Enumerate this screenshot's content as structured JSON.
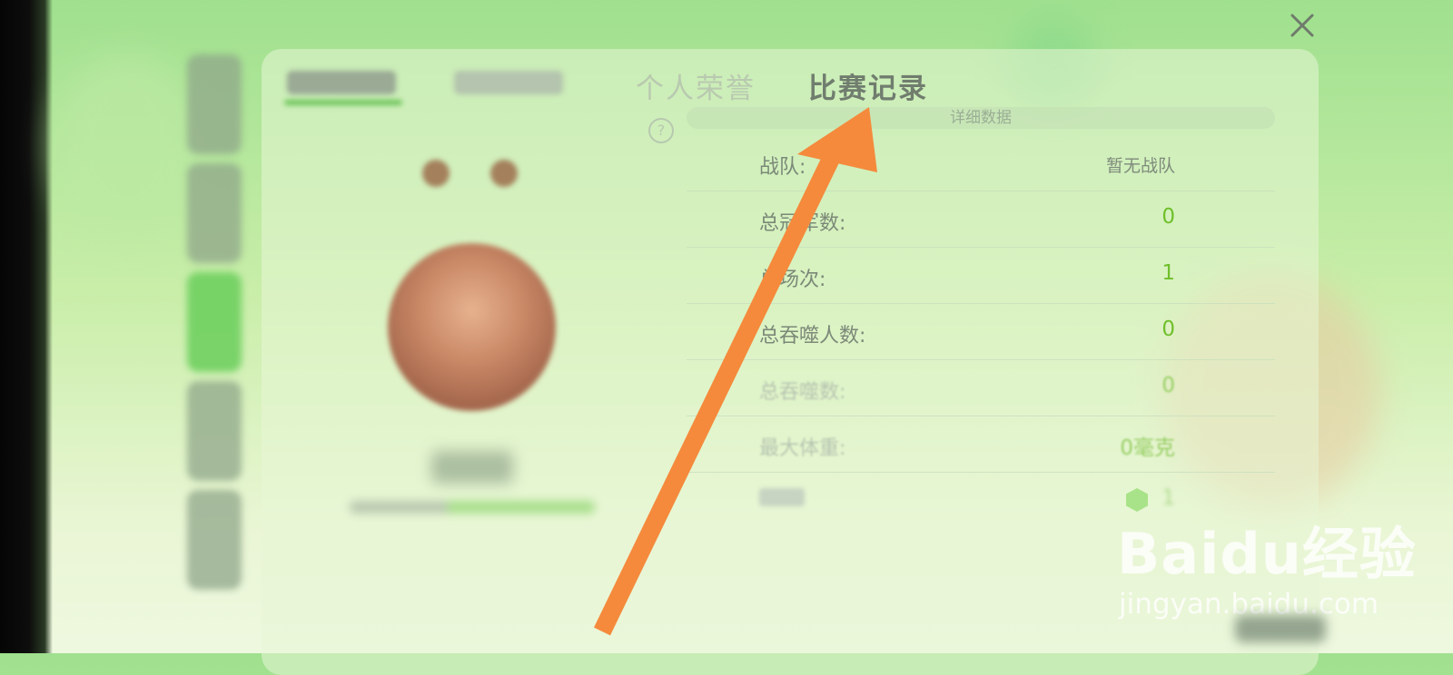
{
  "tabs": [
    {
      "label": "",
      "state": "blurred"
    },
    {
      "label": "",
      "state": "blurred"
    },
    {
      "label": "个人荣誉",
      "state": "inactive"
    },
    {
      "label": "比赛记录",
      "state": "active"
    }
  ],
  "detail_header": "详细数据",
  "stats": [
    {
      "label": "战队:",
      "value": "暂无战队"
    },
    {
      "label": "总冠军数:",
      "value": "0"
    },
    {
      "label": "总场次:",
      "value": "1"
    },
    {
      "label": "总吞噬人数:",
      "value": "0"
    },
    {
      "label": "总吞噬数:",
      "value": "0"
    },
    {
      "label": "最大体重:",
      "value": "0毫克"
    },
    {
      "label": "",
      "value": "1"
    }
  ],
  "icons": {
    "close": "close-icon",
    "help": "help-icon",
    "gem": "gem-icon"
  },
  "help_symbol": "?",
  "watermark": {
    "logo": "Baidu经验",
    "url": "jingyan.baidu.com"
  },
  "colors": {
    "accent_green": "#6fbf2b",
    "annotation_arrow": "#f58a3c",
    "tab_active": "#707d6e"
  }
}
